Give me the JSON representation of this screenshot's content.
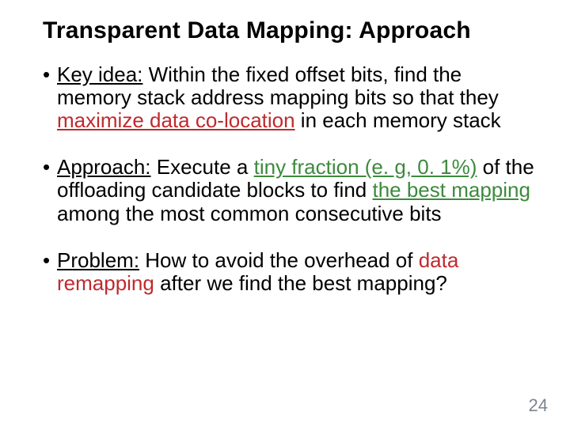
{
  "title": "Transparent Data Mapping: Approach",
  "bullets": {
    "b1": {
      "label": "Key idea:",
      "t1": " Within the fixed offset bits, find the memory stack address mapping bits so that they ",
      "hl": "maximize data co-location",
      "t2": " in each memory stack"
    },
    "b2": {
      "label": "Approach:",
      "t1": " Execute a ",
      "hl1": "tiny fraction (e. g, 0. 1%)",
      "t2": " of the offloading candidate blocks to find ",
      "hl2": "the   best mapping",
      "t3": " among the most common consecutive bits"
    },
    "b3": {
      "label": "Problem:",
      "t1": " How to avoid the overhead of ",
      "hl": "data remapping",
      "t2": " after we find the best mapping?"
    }
  },
  "pagenum": "24"
}
